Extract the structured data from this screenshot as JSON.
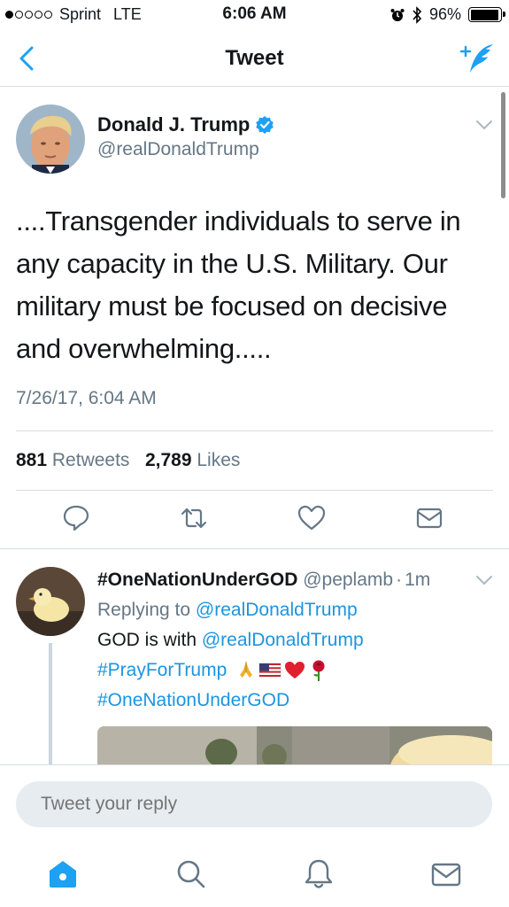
{
  "status_bar": {
    "carrier": "Sprint",
    "network": "LTE",
    "time": "6:06 AM",
    "battery": "96%",
    "battery_level": 0.96,
    "signal_bars_filled": 1,
    "signal_bars_total": 5
  },
  "nav": {
    "title": "Tweet",
    "back_icon": "chevron-left-icon",
    "compose_icon": "compose-tweet-icon"
  },
  "tweet": {
    "author_name": "Donald J. Trump",
    "handle": "@realDonaldTrump",
    "verified": true,
    "text": "....Transgender individuals to  serve in any capacity in the U.S. Military. Our military must be focused on decisive and overwhelming.....",
    "timestamp": "7/26/17, 6:04 AM",
    "retweets_count": "881",
    "retweets_label": "Retweets",
    "likes_count": "2,789",
    "likes_label": "Likes"
  },
  "reply": {
    "author_name": "#OneNationUnderGOD",
    "handle": "@peplamb",
    "separator": "·",
    "time": "1m",
    "replying_prefix": "Replying to",
    "replying_to": "@realDonaldTrump",
    "text_prefix": "GOD is with",
    "mention": "@realDonaldTrump",
    "hashtag1": "#PrayForTrump",
    "hashtag2": "#OneNationUnderGOD",
    "emojis": [
      "folded-hands",
      "us-flag",
      "red-heart",
      "rose"
    ]
  },
  "reply_input": {
    "placeholder": "Tweet your reply"
  },
  "tabbar": {
    "items": [
      "home-icon",
      "search-icon",
      "notifications-icon",
      "messages-icon"
    ]
  },
  "colors": {
    "accent": "#1da1f2",
    "link": "#1b95e0",
    "muted": "#657786",
    "divider": "#d8dde1"
  }
}
